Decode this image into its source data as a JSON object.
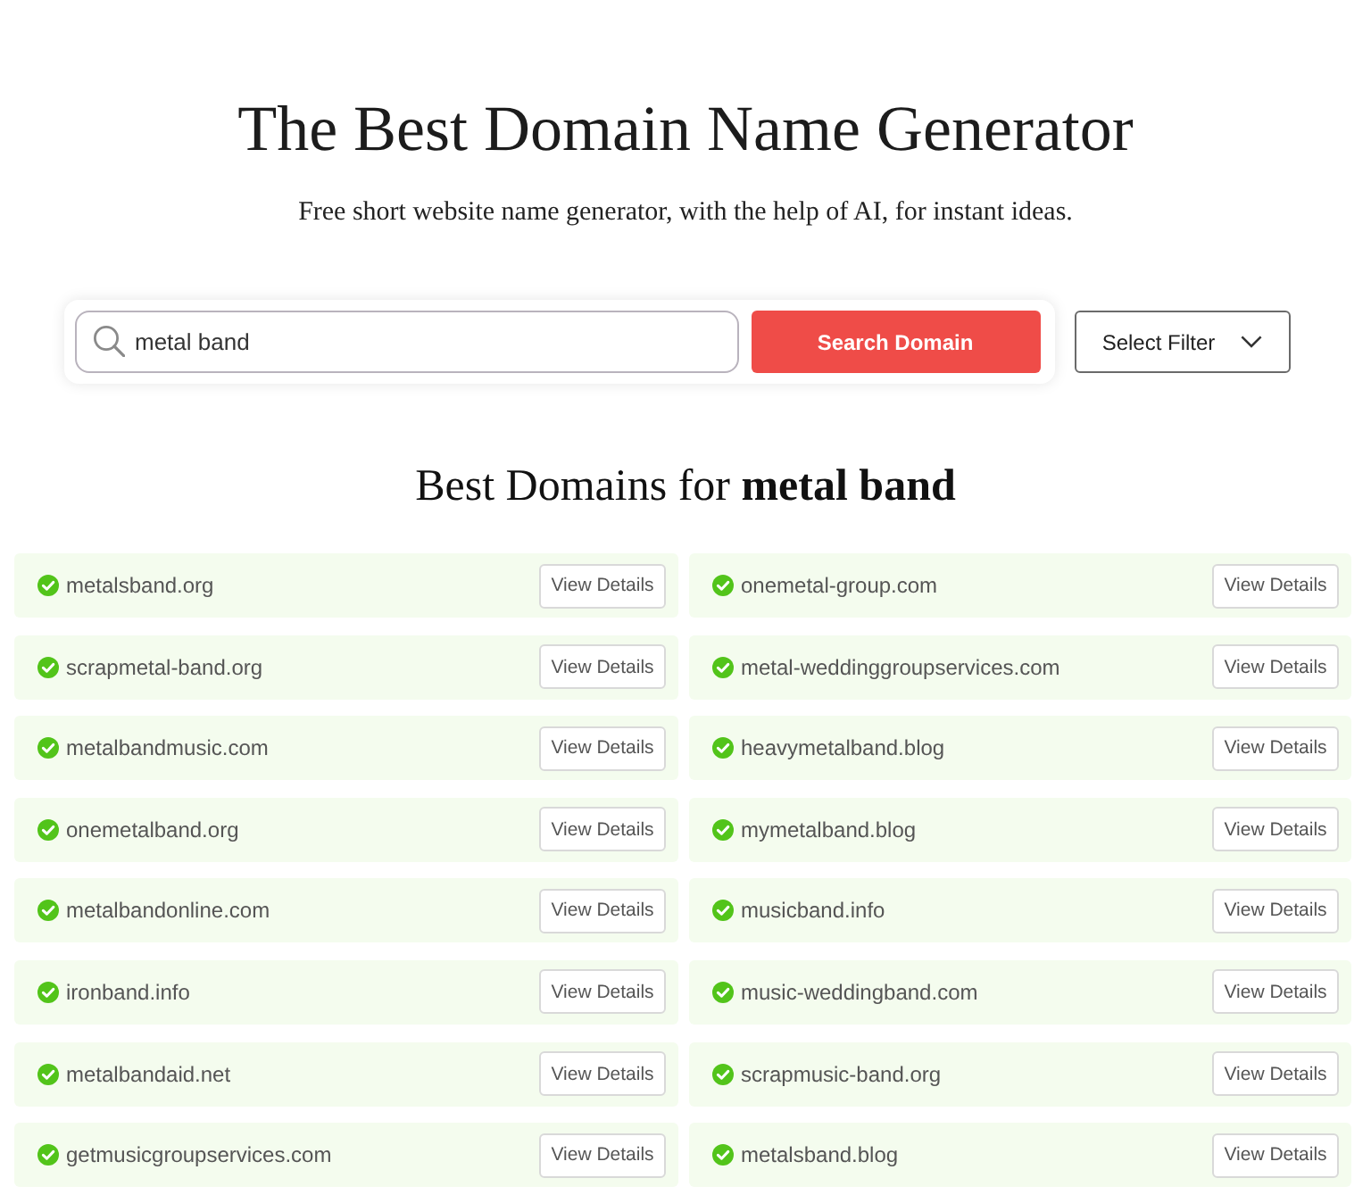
{
  "header": {
    "title": "The Best Domain Name Generator",
    "subtitle": "Free short website name generator, with the help of AI, for instant ideas."
  },
  "search": {
    "value": "metal band",
    "button": "Search Domain",
    "filter": "Select Filter"
  },
  "results": {
    "heading": "Best Domains for **metal band**",
    "items": [
      {
        "domain": "metalsband.org",
        "action": "View Details"
      },
      {
        "domain": "onemetal-group.com",
        "action": "View Details"
      },
      {
        "domain": "scrapmetal-band.org",
        "action": "View Details"
      },
      {
        "domain": "metal-weddinggroupservices.com",
        "action": "View Details"
      },
      {
        "domain": "metalbandmusic.com",
        "action": "View Details"
      },
      {
        "domain": "heavymetalband.blog",
        "action": "View Details"
      },
      {
        "domain": "onemetalband.org",
        "action": "View Details"
      },
      {
        "domain": "mymetalband.blog",
        "action": "View Details"
      },
      {
        "domain": "metalbandonline.com",
        "action": "View Details"
      },
      {
        "domain": "musicband.info",
        "action": "View Details"
      },
      {
        "domain": "ironband.info",
        "action": "View Details"
      },
      {
        "domain": "music-weddingband.com",
        "action": "View Details"
      },
      {
        "domain": "metalbandaid.net",
        "action": "View Details"
      },
      {
        "domain": "scrapmusic-band.org",
        "action": "View Details"
      },
      {
        "domain": "getmusicgroupservices.com",
        "action": "View Details"
      },
      {
        "domain": "metalsband.blog",
        "action": "View Details"
      }
    ]
  }
}
